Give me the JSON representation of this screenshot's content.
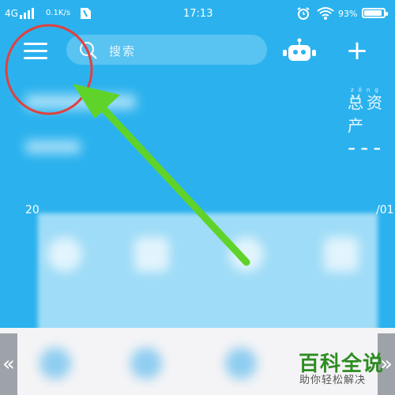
{
  "status_bar": {
    "network": "4G",
    "speed": "0.1K/s",
    "time": "17:13",
    "battery": "93%",
    "battery_level": 0.93
  },
  "header": {
    "search_placeholder": "搜索",
    "plus_label": "+"
  },
  "summary": {
    "total_label": "总资产",
    "total_label_ruby": "zǒng zī",
    "total_value": "---",
    "date_left": "20",
    "date_right": "/01"
  },
  "watermark": {
    "title": "百科全说",
    "subtitle": "助你轻松解决"
  },
  "nav": {
    "left_arrow": "«",
    "right_arrow": "»"
  },
  "colors": {
    "background": "#2bb2ee",
    "annotation_circle": "#e0413f",
    "annotation_arrow": "#5fd32a",
    "watermark_green": "#2e8c22"
  }
}
